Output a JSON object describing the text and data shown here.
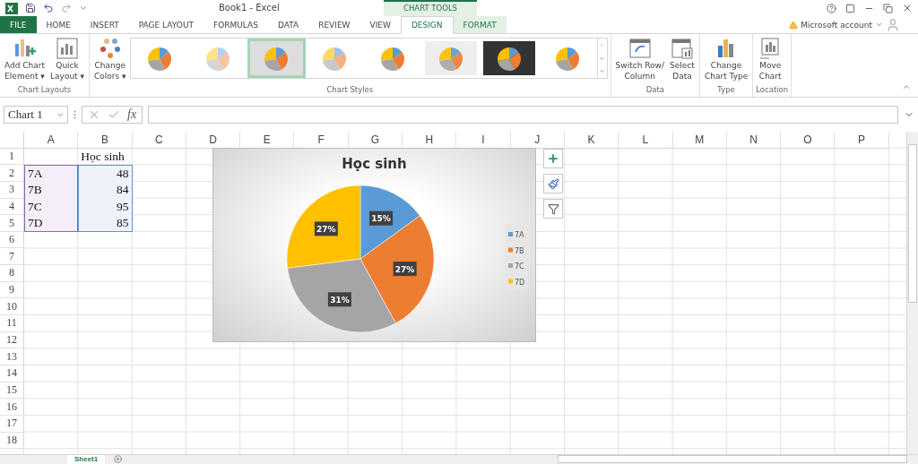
{
  "window": {
    "title": "Book1 - Excel",
    "account": "Microsoft account",
    "context_tab_group": "CHART TOOLS"
  },
  "tabs": [
    {
      "label": "FILE",
      "kind": "file",
      "selected": false
    },
    {
      "label": "HOME",
      "kind": "normal",
      "selected": false
    },
    {
      "label": "INSERT",
      "kind": "normal",
      "selected": false
    },
    {
      "label": "PAGE LAYOUT",
      "kind": "normal",
      "selected": false
    },
    {
      "label": "FORMULAS",
      "kind": "normal",
      "selected": false
    },
    {
      "label": "DATA",
      "kind": "normal",
      "selected": false
    },
    {
      "label": "REVIEW",
      "kind": "normal",
      "selected": false
    },
    {
      "label": "VIEW",
      "kind": "normal",
      "selected": false
    },
    {
      "label": "DESIGN",
      "kind": "context",
      "selected": true
    },
    {
      "label": "FORMAT",
      "kind": "context",
      "selected": false
    }
  ],
  "ribbon": {
    "chart_layouts": {
      "label": "Chart Layouts",
      "buttons": [
        {
          "lines": [
            "Add Chart",
            "Element ▾"
          ],
          "kind": "add-element"
        },
        {
          "lines": [
            "Quick",
            "Layout ▾"
          ],
          "kind": "quick-layout"
        }
      ]
    },
    "change_colors": {
      "lines": [
        "Change",
        "Colors ▾"
      ]
    },
    "chart_styles": {
      "label": "Chart Styles",
      "items": [
        {
          "kind": "plain",
          "selected": false
        },
        {
          "kind": "striped",
          "selected": false
        },
        {
          "kind": "labeled",
          "selected": true
        },
        {
          "kind": "pastel",
          "selected": false
        },
        {
          "kind": "plain",
          "selected": false
        },
        {
          "kind": "hatched",
          "selected": false
        },
        {
          "kind": "dark",
          "selected": false
        },
        {
          "kind": "plain",
          "selected": false
        }
      ]
    },
    "groups": [
      {
        "label": "Data",
        "buttons": [
          {
            "lines": [
              "Switch Row/",
              "Column"
            ],
            "kind": "switch"
          },
          {
            "lines": [
              "Select",
              "Data"
            ],
            "kind": "select-data"
          }
        ]
      },
      {
        "label": "Type",
        "buttons": [
          {
            "lines": [
              "Change",
              "Chart Type"
            ],
            "kind": "chart-type"
          }
        ]
      },
      {
        "label": "Location",
        "buttons": [
          {
            "lines": [
              "Move",
              "Chart"
            ],
            "kind": "move"
          }
        ]
      }
    ]
  },
  "formula_bar": {
    "name_box": "Chart 1",
    "fx": "fx"
  },
  "sheet": {
    "columns": [
      "A",
      "B",
      "C",
      "D",
      "E",
      "F",
      "G",
      "H",
      "I",
      "J",
      "K",
      "L",
      "M",
      "N",
      "O",
      "P"
    ],
    "rows": [
      "1",
      "2",
      "3",
      "4",
      "5",
      "6",
      "7",
      "8",
      "9",
      "10",
      "11",
      "12",
      "13",
      "14",
      "15",
      "16",
      "17",
      "18"
    ],
    "header": "Học sinh",
    "data": [
      {
        "label": "7A",
        "value": "48"
      },
      {
        "label": "7B",
        "value": "84"
      },
      {
        "label": "7C",
        "value": "95"
      },
      {
        "label": "7D",
        "value": "85"
      }
    ]
  },
  "chart": {
    "chart_data": {
      "type": "pie",
      "title": "Học sinh",
      "categories": [
        "7A",
        "7B",
        "7C",
        "7D"
      ],
      "series": [
        {
          "values": [
            15,
            27,
            31,
            27
          ]
        }
      ],
      "legend": "right",
      "value_labels": [
        "15%",
        "27%",
        "31%",
        "27%"
      ]
    }
  },
  "sheet_tabs": [
    {
      "label": "Sheet1",
      "selected": true
    }
  ]
}
